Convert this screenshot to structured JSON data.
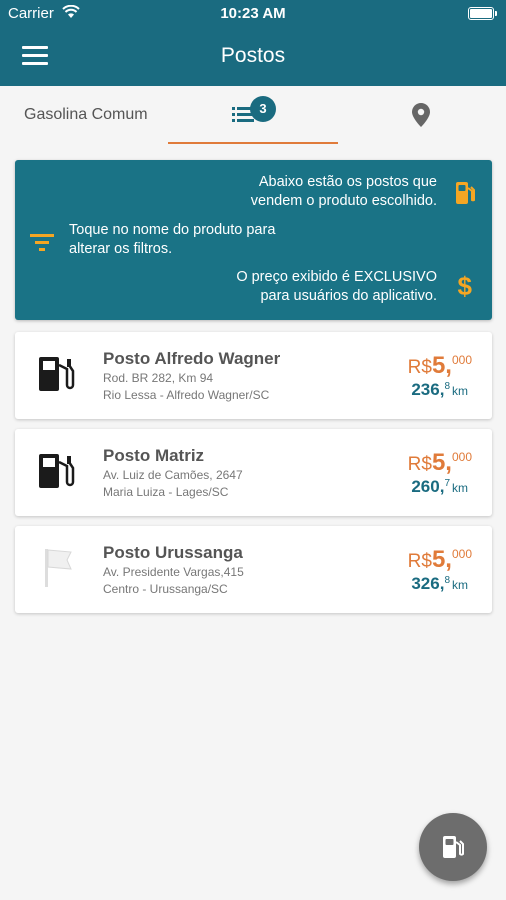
{
  "status_bar": {
    "carrier": "Carrier",
    "time": "10:23 AM"
  },
  "header": {
    "title": "Postos"
  },
  "tabs": {
    "product": "Gasolina Comum",
    "list_badge": "3"
  },
  "info": {
    "line1": "Abaixo estão os postos que\nvendem o produto escolhido.",
    "line2": "Toque no nome do produto para\nalterar os filtros.",
    "line3": "O preço exibido é EXCLUSIVO\npara usuários do aplicativo.",
    "dollar": "$"
  },
  "stations": [
    {
      "name": "Posto Alfredo Wagner",
      "address1": "Rod. BR 282, Km 94",
      "address2": "Rio Lessa - Alfredo Wagner/SC",
      "price_currency": "R$",
      "price_int": "5,",
      "price_dec": "000",
      "dist_int": "236,",
      "dist_dec": "8",
      "dist_unit": "km",
      "icon": "fuel-pump-icon"
    },
    {
      "name": "Posto Matriz",
      "address1": "Av. Luiz de Camões, 2647",
      "address2": "Maria Luiza - Lages/SC",
      "price_currency": "R$",
      "price_int": "5,",
      "price_dec": "000",
      "dist_int": "260,",
      "dist_dec": "7",
      "dist_unit": "km",
      "icon": "fuel-pump-icon"
    },
    {
      "name": "Posto Urussanga",
      "address1": "Av. Presidente Vargas,415",
      "address2": "Centro - Urussanga/SC",
      "price_currency": "R$",
      "price_int": "5,",
      "price_dec": "000",
      "dist_int": "326,",
      "dist_dec": "8",
      "dist_unit": "km",
      "icon": "flag-icon"
    }
  ],
  "colors": {
    "primary": "#1a6b80",
    "accent": "#e07b3a",
    "warning": "#f5a623"
  }
}
